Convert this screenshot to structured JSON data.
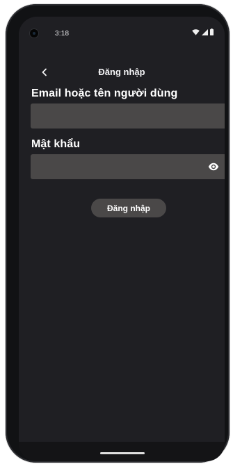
{
  "status_bar": {
    "time": "3:18",
    "icons": [
      "wifi-icon",
      "cell-signal-icon",
      "battery-icon"
    ]
  },
  "appbar": {
    "back_icon": "chevron-left-icon",
    "title": "Đăng nhập"
  },
  "form": {
    "email_label": "Email hoặc tên người dùng",
    "email_value": "",
    "email_placeholder": "",
    "password_label": "Mật khẩu",
    "password_value": "",
    "password_placeholder": "",
    "visibility_icon": "eye-icon",
    "submit_label": "Đăng nhập"
  },
  "colors": {
    "background": "#1f1f23",
    "field": "#4a4848",
    "text": "#ffffff"
  }
}
